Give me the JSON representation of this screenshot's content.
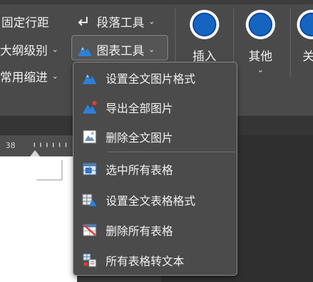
{
  "ribbon": {
    "left_items": [
      {
        "label": "固定行距"
      },
      {
        "label": "大纲级别"
      },
      {
        "label": "常用缩进"
      }
    ],
    "paragraph_tool": {
      "label": "段落工具",
      "icon": "return-arrow-icon"
    },
    "chart_tool": {
      "label": "图表工具",
      "icon": "mountain-chart-icon"
    },
    "big_buttons": [
      {
        "label": "插入",
        "icon": "blue-orb-icon"
      },
      {
        "label": "其他",
        "icon": "blue-orb-icon"
      },
      {
        "label": "关",
        "icon": "blue-orb-icon"
      }
    ],
    "chevron": "⌄"
  },
  "ruler": {
    "number": "38"
  },
  "menu": {
    "items": [
      {
        "label": "设置全文图片格式",
        "icon": "image-format-icon"
      },
      {
        "label": "导出全部图片",
        "icon": "image-export-icon"
      },
      {
        "label": "删除全文图片",
        "icon": "image-delete-icon"
      },
      {
        "label": "选中所有表格",
        "icon": "table-select-icon"
      },
      {
        "label": "设置全文表格格式",
        "icon": "table-format-icon"
      },
      {
        "label": "删除所有表格",
        "icon": "table-delete-icon"
      },
      {
        "label": "所有表格转文本",
        "icon": "table-to-text-icon"
      }
    ]
  },
  "colors": {
    "ribbon_bg": "#4a4a4a",
    "menu_bg": "#4b4b4b",
    "accent_blue": "#1565c0"
  }
}
